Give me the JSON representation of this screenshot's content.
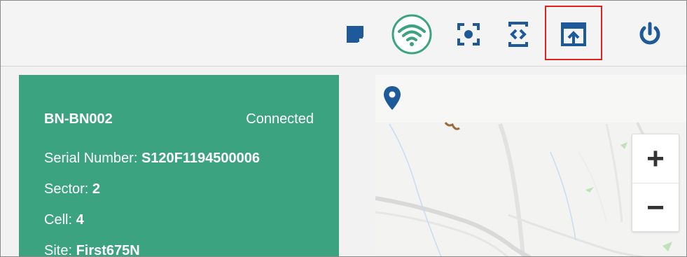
{
  "colors": {
    "accent_blue": "#1e5a99",
    "connected_green": "#3ba37f",
    "highlight_red": "#e2231a"
  },
  "toolbar": {
    "icons": [
      "note-icon",
      "wifi-icon",
      "focus-icon",
      "code-icon",
      "upload-icon",
      "power-icon"
    ]
  },
  "device": {
    "name": "BN-BN002",
    "status": "Connected",
    "serial_label": "Serial Number: ",
    "serial_value": "S120F1194500006",
    "sector_label": "Sector: ",
    "sector_value": "2",
    "cell_label": "Cell: ",
    "cell_value": "4",
    "site_label": "Site: ",
    "site_value": "First675N"
  },
  "map": {
    "zoom_in_label": "+",
    "zoom_out_label": "−"
  }
}
